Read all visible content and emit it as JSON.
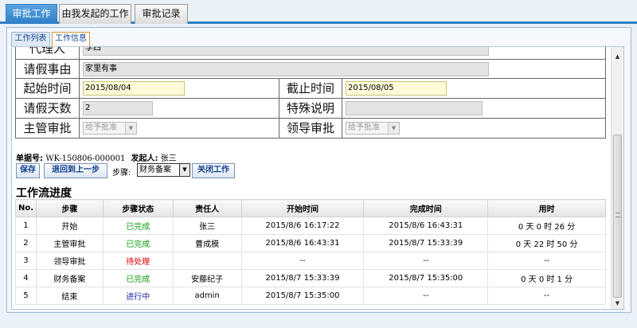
{
  "top_tabs": [
    "审批工作",
    "由我发起的工作",
    "审批记录"
  ],
  "sub_tabs": [
    "工作列表",
    "工作信息"
  ],
  "form": {
    "agent_label": "代理人",
    "agent_value": "李四",
    "reason_label": "请假事由",
    "reason_value": "家里有事",
    "start_label": "起始时间",
    "start_value": "2015/08/04",
    "end_label": "截止时间",
    "end_value": "2015/08/05",
    "days_label": "请假天数",
    "days_value": "2",
    "special_label": "特殊说明",
    "special_value": "",
    "manager_label": "主管审批",
    "manager_value": "给予批准",
    "leader_label": "领导审批",
    "leader_value": "给予批准"
  },
  "meta": {
    "order_label": "单据号:",
    "order_value": "WK-150806-000001",
    "initiator_label": "发起人:",
    "initiator_value": "张三"
  },
  "actions": {
    "save": "保存",
    "back": "退回到上一步",
    "step_label": "步骤:",
    "step_value": "财务备案",
    "close": "关闭工作"
  },
  "progress": {
    "title": "工作流进度",
    "columns": [
      "No.",
      "步骤",
      "步骤状态",
      "责任人",
      "开始时间",
      "完成时间",
      "用时"
    ],
    "rows": [
      {
        "no": "1",
        "step": "开始",
        "status": "已完成",
        "status_type": "done",
        "owner": "张三",
        "start": "2015/8/6 16:17:22",
        "end": "2015/8/6 16:43:31",
        "duration": "0 天 0 时 26 分"
      },
      {
        "no": "2",
        "step": "主管审批",
        "status": "已完成",
        "status_type": "done",
        "owner": "曹成模",
        "start": "2015/8/6 16:43:31",
        "end": "2015/8/7 15:33:39",
        "duration": "0 天 22 时 50 分"
      },
      {
        "no": "3",
        "step": "领导审批",
        "status": "待处理",
        "status_type": "pending",
        "owner": "",
        "start": "--",
        "end": "--",
        "duration": "--"
      },
      {
        "no": "4",
        "step": "财务备案",
        "status": "已完成",
        "status_type": "done",
        "owner": "安藤纪子",
        "start": "2015/8/7 15:33:39",
        "end": "2015/8/7 15:35:00",
        "duration": "0 天 0 时 1 分"
      },
      {
        "no": "5",
        "step": "结束",
        "status": "进行中",
        "status_type": "progress",
        "owner": "admin",
        "start": "2015/8/7 15:35:00",
        "end": "--",
        "duration": "--"
      }
    ]
  },
  "colors": {
    "accent": "#2f7fc6",
    "done": "#129c12",
    "pending": "#e00000",
    "in_progress": "#1a2aa8"
  }
}
